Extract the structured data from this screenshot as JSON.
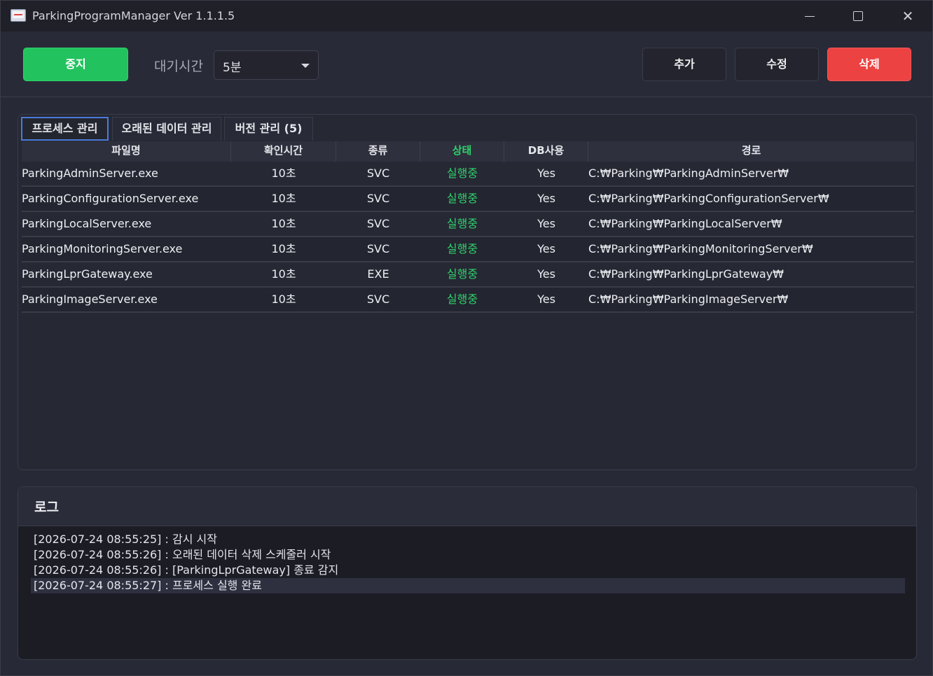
{
  "window": {
    "title": "ParkingProgramManager Ver 1.1.1.5",
    "close_glyph": "✕"
  },
  "toolbar": {
    "stop_label": "중지",
    "wait_label": "대기시간",
    "wait_value": "5분",
    "add_label": "추가",
    "edit_label": "수정",
    "delete_label": "삭제"
  },
  "tabs": [
    {
      "label": "프로세스 관리",
      "active": true
    },
    {
      "label": "오래된 데이터 관리",
      "active": false
    },
    {
      "label": "버전 관리 (5)",
      "active": false
    }
  ],
  "table": {
    "headers": {
      "name": "파일명",
      "check_time": "확인시간",
      "type": "종류",
      "status": "상태",
      "db": "DB사용",
      "path": "경로"
    },
    "rows": [
      {
        "name": "ParkingAdminServer.exe",
        "check_time": "10초",
        "type": "SVC",
        "status": "실행중",
        "db": "Yes",
        "path": "C:₩Parking₩ParkingAdminServer₩"
      },
      {
        "name": "ParkingConfigurationServer.exe",
        "check_time": "10초",
        "type": "SVC",
        "status": "실행중",
        "db": "Yes",
        "path": "C:₩Parking₩ParkingConfigurationServer₩"
      },
      {
        "name": "ParkingLocalServer.exe",
        "check_time": "10초",
        "type": "SVC",
        "status": "실행중",
        "db": "Yes",
        "path": "C:₩Parking₩ParkingLocalServer₩"
      },
      {
        "name": "ParkingMonitoringServer.exe",
        "check_time": "10초",
        "type": "SVC",
        "status": "실행중",
        "db": "Yes",
        "path": "C:₩Parking₩ParkingMonitoringServer₩"
      },
      {
        "name": "ParkingLprGateway.exe",
        "check_time": "10초",
        "type": "EXE",
        "status": "실행중",
        "db": "Yes",
        "path": "C:₩Parking₩ParkingLprGateway₩"
      },
      {
        "name": "ParkingImageServer.exe",
        "check_time": "10초",
        "type": "SVC",
        "status": "실행중",
        "db": "Yes",
        "path": "C:₩Parking₩ParkingImageServer₩"
      }
    ]
  },
  "log": {
    "title": "로그",
    "lines": [
      "[2026-07-24 08:55:25] : 감시 시작",
      "[2026-07-24 08:55:26] : 오래된 데이터 삭제 스케줄러 시작",
      "[2026-07-24 08:55:26] : [ParkingLprGateway] 종료 감지",
      "[2026-07-24 08:55:27] : 프로세스 실행 완료"
    ],
    "selected_index": 3
  },
  "colors": {
    "stop_button": "#22c35e",
    "delete_button": "#ec4242",
    "status_running": "#2fd36b",
    "active_tab_border": "#4b7bd8"
  }
}
